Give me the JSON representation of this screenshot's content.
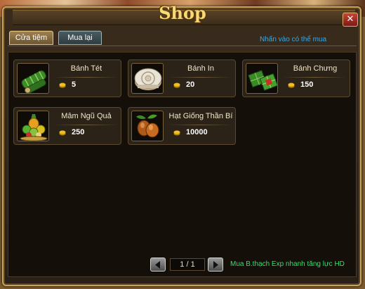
{
  "window": {
    "title": "Shop",
    "close_label": "✕"
  },
  "tabs": [
    {
      "label": "Cửa tiệm",
      "active": true
    },
    {
      "label": "Mua lại",
      "active": false
    }
  ],
  "hint": "Nhấn vào có thể mua",
  "items": [
    {
      "name": "Bánh Tét",
      "price": "5",
      "icon": "banh-tet-icon"
    },
    {
      "name": "Bánh In",
      "price": "20",
      "icon": "banh-in-icon"
    },
    {
      "name": "Bánh Chưng",
      "price": "150",
      "icon": "banh-chung-icon"
    },
    {
      "name": "Mâm Ngũ Quả",
      "price": "250",
      "icon": "fruit-tray-icon"
    },
    {
      "name": "Hạt Giống Thần Bí",
      "price": "10000",
      "icon": "mystic-seed-icon"
    }
  ],
  "pagination": {
    "label": "1 / 1"
  },
  "promo": "Mua B.thạch Exp nhanh tăng lực HD",
  "colors": {
    "gold_border": "#c9a35a",
    "hint": "#38a9e8",
    "promo": "#2fe36a",
    "coin": "#f0c020"
  }
}
